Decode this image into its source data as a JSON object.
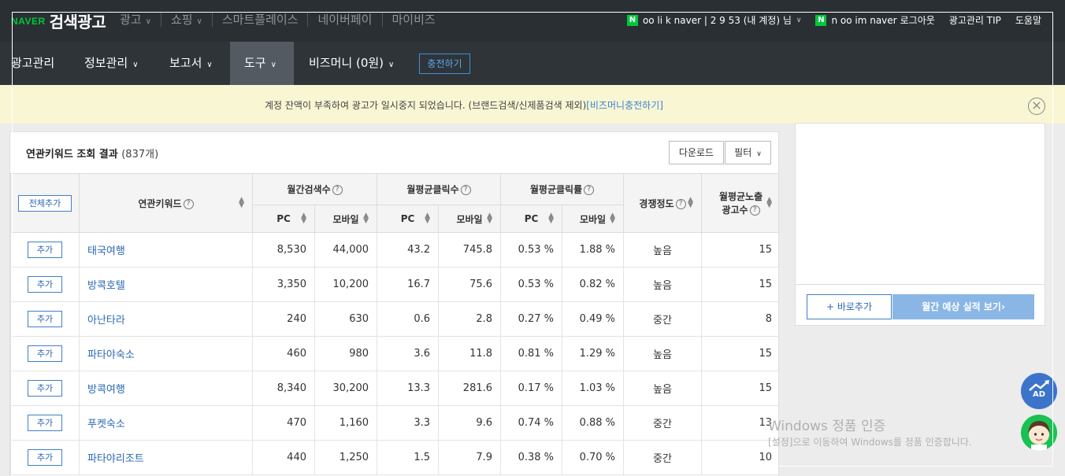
{
  "header": {
    "logo_naver": "NAVER",
    "logo_product": "검색광고",
    "gnb": [
      {
        "label": "광고",
        "has_dropdown": true
      },
      {
        "label": "쇼핑",
        "has_dropdown": true
      },
      {
        "label": "스마트플레이스",
        "has_dropdown": false
      },
      {
        "label": "네이버페이",
        "has_dropdown": false
      },
      {
        "label": "마이비즈",
        "has_dropdown": false
      }
    ],
    "account_label": "oo li k naver | 2 9 53 (내 계정) 님",
    "login_id": "n oo  im naver",
    "logout": "로그아웃",
    "tip": "광고관리 TIP",
    "help": "도움말"
  },
  "menu": {
    "items": [
      "광고관리",
      "정보관리",
      "보고서",
      "도구",
      "비즈머니 (0원)"
    ],
    "active": "도구",
    "charge": "충전하기"
  },
  "notice": {
    "message": "계정 잔액이 부족하여 광고가 일시중지 되었습니다. (브랜드검색/신제품검색 제외)",
    "link": "[비즈머니충전하기]"
  },
  "results": {
    "title": "연관키워드 조회 결과",
    "count": "(837개)",
    "download": "다운로드",
    "filter": "필터",
    "add_all": "전체추가",
    "add_label": "추가",
    "columns": {
      "keyword": "연관키워드",
      "monthly_search": "월간검색수",
      "monthly_clicks": "월평균클릭수",
      "monthly_ctr": "월평균클릭률",
      "competition": "경쟁정도",
      "ad_count_l1": "월평균노출",
      "ad_count_l2": "광고수",
      "pc": "PC",
      "mobile": "모바일"
    },
    "rows": [
      {
        "keyword": "태국여행",
        "search_pc": "8,530",
        "search_mobile": "44,000",
        "click_pc": "43.2",
        "click_mobile": "745.8",
        "ctr_pc": "0.53 %",
        "ctr_mobile": "1.88 %",
        "competition": "높음",
        "ads": "15"
      },
      {
        "keyword": "방콕호텔",
        "search_pc": "3,350",
        "search_mobile": "10,200",
        "click_pc": "16.7",
        "click_mobile": "75.6",
        "ctr_pc": "0.53 %",
        "ctr_mobile": "0.82 %",
        "competition": "높음",
        "ads": "15"
      },
      {
        "keyword": "아난타라",
        "search_pc": "240",
        "search_mobile": "630",
        "click_pc": "0.6",
        "click_mobile": "2.8",
        "ctr_pc": "0.27 %",
        "ctr_mobile": "0.49 %",
        "competition": "중간",
        "ads": "8"
      },
      {
        "keyword": "파타야숙소",
        "search_pc": "460",
        "search_mobile": "980",
        "click_pc": "3.6",
        "click_mobile": "11.8",
        "ctr_pc": "0.81 %",
        "ctr_mobile": "1.29 %",
        "competition": "높음",
        "ads": "15"
      },
      {
        "keyword": "방콕여행",
        "search_pc": "8,340",
        "search_mobile": "30,200",
        "click_pc": "13.3",
        "click_mobile": "281.6",
        "ctr_pc": "0.17 %",
        "ctr_mobile": "1.03 %",
        "competition": "높음",
        "ads": "15"
      },
      {
        "keyword": "푸켓숙소",
        "search_pc": "470",
        "search_mobile": "1,160",
        "click_pc": "3.3",
        "click_mobile": "9.6",
        "ctr_pc": "0.74 %",
        "ctr_mobile": "0.88 %",
        "competition": "중간",
        "ads": "13"
      },
      {
        "keyword": "파타야리조트",
        "search_pc": "440",
        "search_mobile": "1,250",
        "click_pc": "1.5",
        "click_mobile": "7.9",
        "ctr_pc": "0.38 %",
        "ctr_mobile": "0.70 %",
        "competition": "중간",
        "ads": "10"
      }
    ]
  },
  "side": {
    "direct_add": "+ 바로추가",
    "forecast": "월간 예상 실적 보기›"
  },
  "fab": {
    "ad_label": "AD"
  },
  "watermark": {
    "line1": "Windows 정품 인증",
    "line2": "[설정]으로 이동하여 Windows를 정품 인증합니다."
  },
  "colors": {
    "naver_green": "#00c73c",
    "link_blue": "#2a67b0",
    "notice_bg": "#f9f6d4",
    "topbar_bg": "#2a2f33"
  }
}
